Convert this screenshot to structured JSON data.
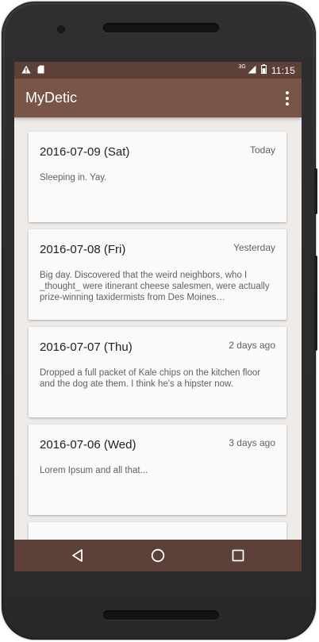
{
  "status_bar": {
    "time": "11:15",
    "network_label": "3G",
    "left_icons": [
      "warning-icon",
      "sd-card-icon"
    ],
    "right_icons": [
      "signal-icon",
      "battery-icon"
    ]
  },
  "app_bar": {
    "title": "MyDetic",
    "overflow_icon": "more-vert-icon"
  },
  "entries": [
    {
      "date": "2016-07-09 (Sat)",
      "relative": "Today",
      "body": "Sleeping in. Yay."
    },
    {
      "date": "2016-07-08 (Fri)",
      "relative": "Yesterday",
      "body": "Big day. Discovered that the weird neighbors, who I _thought_ were itinerant cheese salesmen, were actually prize-winning taxidermists from Des Moines…"
    },
    {
      "date": "2016-07-07 (Thu)",
      "relative": "2 days ago",
      "body": "Dropped a full packet of Kale chips on the kitchen floor and the dog ate them. I think he's a hipster now."
    },
    {
      "date": "2016-07-06 (Wed)",
      "relative": "3 days ago",
      "body": "Lorem Ipsum and all that..."
    }
  ],
  "nav_bar": {
    "buttons": [
      "back-icon",
      "home-icon",
      "recents-icon"
    ]
  },
  "colors": {
    "status_bar": "#5d4037",
    "app_bar": "#795548",
    "background": "#efebe9",
    "card": "#fafafa",
    "nav_bar": "#5d4037"
  }
}
